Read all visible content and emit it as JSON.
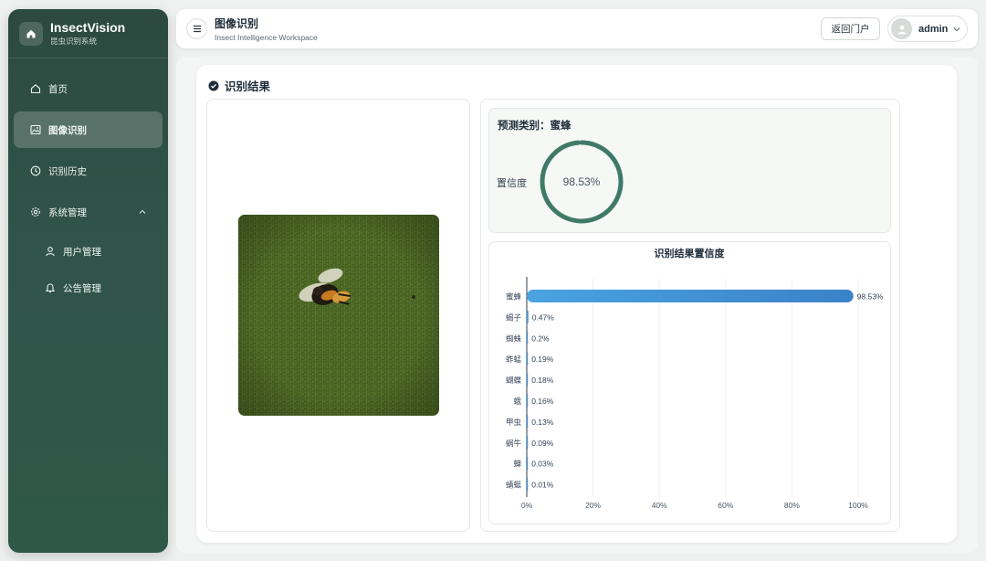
{
  "brand": {
    "name": "InsectVision",
    "subtitle": "昆虫识别系统"
  },
  "sidebar": {
    "items": [
      {
        "label": "首页",
        "icon": "home-icon"
      },
      {
        "label": "图像识别",
        "icon": "image-icon",
        "active": true
      },
      {
        "label": "识别历史",
        "icon": "clock-icon"
      },
      {
        "label": "系统管理",
        "icon": "gear-icon",
        "expanded": true
      }
    ],
    "subitems": [
      {
        "label": "用户管理",
        "icon": "user-icon"
      },
      {
        "label": "公告管理",
        "icon": "bell-icon"
      }
    ]
  },
  "header": {
    "title": "图像识别",
    "subtitle": "Insect Intelligence Workspace",
    "portal_button": "返回门户",
    "username": "admin"
  },
  "main": {
    "section_title": "识别结果",
    "prediction_prefix": "预测类别：",
    "prediction_value": "蜜蜂",
    "confidence_label": "置信度",
    "confidence_text": "98.53%",
    "confidence_value": 98.53
  },
  "colors": {
    "accent": "#3f7a68",
    "bar_start": "#4aa3e0",
    "bar_end": "#3a82c8"
  },
  "chart_data": {
    "type": "bar",
    "orientation": "horizontal",
    "title": "识别结果置信度",
    "categories": [
      "蜜蜂",
      "蝎子",
      "蜘蛛",
      "蚱蜢",
      "蝴蝶",
      "蛾",
      "甲虫",
      "蜗牛",
      "蝉",
      "蜻蜓"
    ],
    "values": [
      98.53,
      0.47,
      0.2,
      0.19,
      0.18,
      0.16,
      0.13,
      0.09,
      0.03,
      0.01
    ],
    "value_labels": [
      "98.53%",
      "0.47%",
      "0.2%",
      "0.19%",
      "0.18%",
      "0.16%",
      "0.13%",
      "0.09%",
      "0.03%",
      "0.01%"
    ],
    "xticks": [
      "0%",
      "20%",
      "40%",
      "60%",
      "80%",
      "100%"
    ],
    "xlim": [
      0,
      100
    ],
    "grid": true
  }
}
